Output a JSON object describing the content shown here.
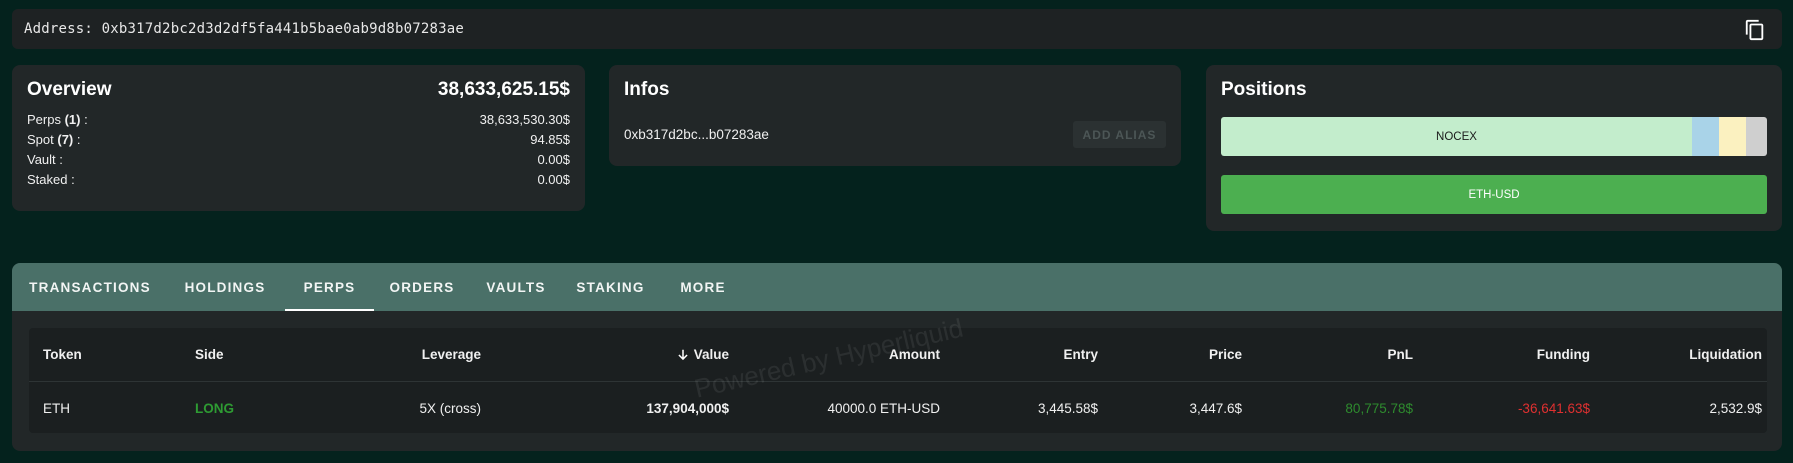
{
  "address_bar": {
    "text": "Address: 0xb317d2bc2d3d2df5fa441b5bae0ab9d8b07283ae",
    "copy_icon": "copy-icon"
  },
  "overview": {
    "title": "Overview",
    "total": "38,633,625.15$",
    "rows": [
      {
        "label": "Perps ",
        "count": "(1)",
        "suffix": " :",
        "value": "38,633,530.30$"
      },
      {
        "label": "Spot ",
        "count": "(7)",
        "suffix": " :",
        "value": "94.85$"
      },
      {
        "label": "Vault :",
        "count": "",
        "suffix": "",
        "value": "0.00$"
      },
      {
        "label": "Staked :",
        "count": "",
        "suffix": "",
        "value": "0.00$"
      }
    ]
  },
  "infos": {
    "title": "Infos",
    "short_address": "0xb317d2bc...b07283ae",
    "alias_button": "ADD ALIAS"
  },
  "positions": {
    "title": "Positions",
    "bar1": [
      {
        "label": "NOCEX",
        "color": "#c3edcc"
      },
      {
        "label": "",
        "color": "#a9d3e8"
      },
      {
        "label": "",
        "color": "#fbf1c0"
      },
      {
        "label": "",
        "color": "#cfcfcf"
      }
    ],
    "bar2_label": "ETH-USD",
    "bar2_color": "#4caf50"
  },
  "tabs": [
    "TRANSACTIONS",
    "HOLDINGS",
    "PERPS",
    "ORDERS",
    "VAULTS",
    "STAKING",
    "MORE"
  ],
  "active_tab": "PERPS",
  "table": {
    "columns": [
      "Token",
      "Side",
      "Leverage",
      "Value",
      "Amount",
      "Entry",
      "Price",
      "PnL",
      "Funding",
      "Liquidation"
    ],
    "sort_icon": "arrow-down-icon",
    "rows": [
      {
        "token": "ETH",
        "side": "LONG",
        "leverage": "5X (cross)",
        "value": "137,904,000$",
        "amount": "40000.0 ETH-USD",
        "entry": "3,445.58$",
        "price": "3,447.6$",
        "pnl": "80,775.78$",
        "funding": "-36,641.63$",
        "liquidation": "2,532.9$"
      }
    ]
  },
  "watermark": "Powered by Hyperliquid",
  "colors": {
    "background": "#04221d",
    "card": "#222728",
    "tab_bar": "#4a7068",
    "long": "#2e9b33",
    "negative": "#e03030"
  }
}
